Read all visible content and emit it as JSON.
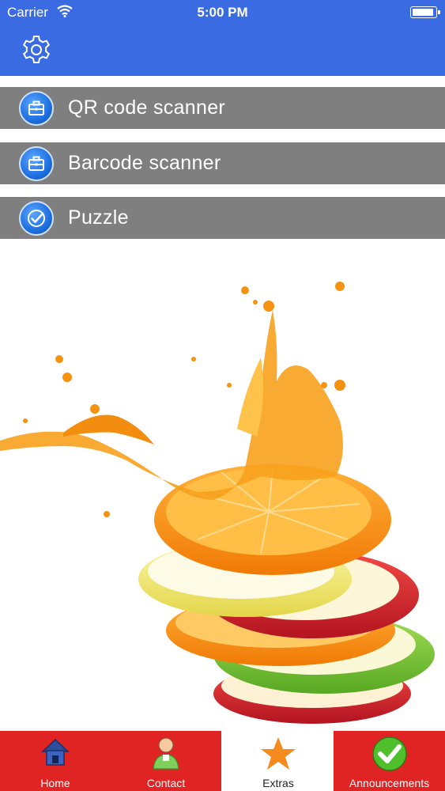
{
  "status_bar": {
    "carrier": "Carrier",
    "time": "5:00 PM",
    "battery_level": 1.0
  },
  "header": {
    "background_color": "#3a6be3",
    "settings_icon": "gear-icon"
  },
  "menu": {
    "background_color": "#7f7f7f",
    "items": [
      {
        "label": "QR code scanner",
        "icon": "briefcase-icon"
      },
      {
        "label": "Barcode scanner",
        "icon": "briefcase-icon"
      },
      {
        "label": "Puzzle",
        "icon": "checkmark-icon"
      }
    ]
  },
  "tabbar": {
    "active_tab": "Extras",
    "tab_color": "#e02424",
    "tabs": [
      {
        "label": "Home",
        "icon": "house-icon"
      },
      {
        "label": "Contact",
        "icon": "person-icon"
      },
      {
        "label": "Extras",
        "icon": "star-icon"
      },
      {
        "label": "Announcements",
        "icon": "check-circle-icon"
      }
    ]
  }
}
